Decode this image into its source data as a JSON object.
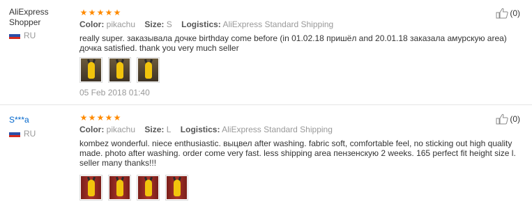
{
  "colors": {
    "star": "#ff8a00",
    "link": "#0066cc",
    "muted": "#999999",
    "divider": "#e5e5e5"
  },
  "reviews": [
    {
      "user": "AliExpress Shopper",
      "country": "RU",
      "rating": 5,
      "color_label": "Color:",
      "color_value": "pikachu",
      "size_label": "Size:",
      "size_value": "S",
      "logistics_label": "Logistics:",
      "logistics_value": "AliExpress Standard Shipping",
      "text": "really super. заказывала дочке birthday come before (in 01.02.18 пришёл and 20.01.18 заказала амурскую area) дочка satisfied. thank you very much seller",
      "photos": 3,
      "date": "05 Feb 2018 01:40",
      "helpful_count": "(0)"
    },
    {
      "user": "S***a",
      "country": "RU",
      "rating": 5,
      "color_label": "Color:",
      "color_value": "pikachu",
      "size_label": "Size:",
      "size_value": "L",
      "logistics_label": "Logistics:",
      "logistics_value": "AliExpress Standard Shipping",
      "text": "kombez wonderful. niece enthusiastic. выцвел after washing. fabric soft, comfortable feel, no sticking out high quality made. photo after washing. order come very fast. less shipping area пензенскую 2 weeks. 165 perfect fit height size l. seller many thanks!!!",
      "photos": 4,
      "date": "",
      "helpful_count": "(0)"
    }
  ]
}
